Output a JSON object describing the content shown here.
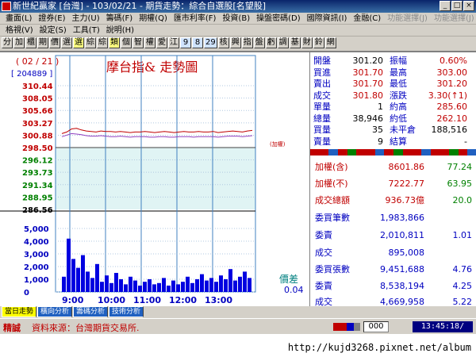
{
  "window": {
    "title": "新世紀贏家 [台灣] - 103/02/21 - 期貨走勢：綜合自選股[名望股]"
  },
  "menu": {
    "row1": [
      "畫面(L)",
      "證券(E)",
      "主力(U)",
      "籌碼(F)",
      "期權(Q)",
      "匯市利率(F)",
      "投資(B)",
      "操盤密碼(D)",
      "國際資訊(I)",
      "金融(C)",
      "功能選擇(J)",
      "功能選擇(J)"
    ],
    "row2": [
      "格視(V)",
      "設定(S)",
      "工具(T)",
      "說明(H)"
    ]
  },
  "toolbar": {
    "buttons": [
      "分",
      "加",
      "櫃",
      "期",
      "價",
      "選",
      "選",
      "綜",
      "綜",
      "類",
      "個",
      "智",
      "權",
      "愛",
      "江",
      "9",
      "8",
      "29",
      "核",
      "興",
      "指",
      "盤",
      "虧",
      "調",
      "基",
      "財",
      "鈴",
      "網"
    ]
  },
  "chart_data": {
    "type": "line",
    "title": "摩台指&  走勢圖",
    "date_label": "( 02 / 21 )",
    "volume_label": "[ 204889 ]",
    "reference_label": "(加權)",
    "y_ticks": [
      "310.44",
      "308.05",
      "305.66",
      "303.27",
      "300.88",
      "298.50",
      "296.12",
      "293.73",
      "291.34",
      "288.95",
      "286.56"
    ],
    "ylim": [
      286.56,
      310.44
    ],
    "reference_price": 298.5,
    "vol_ticks": [
      "5,000",
      "4,000",
      "3,000",
      "2,000",
      "1,000",
      "0"
    ],
    "vol_max": 5000,
    "x_ticks": [
      "9:00",
      "10:00",
      "11:00",
      "12:00",
      "13:00"
    ],
    "series": [
      {
        "values": [
          301.2,
          301.5,
          302.1,
          302.2,
          301.9,
          301.7,
          301.6,
          301.5,
          301.7,
          301.6,
          301.6,
          301.5,
          301.6,
          301.5,
          301.4,
          301.5,
          301.5,
          301.6,
          301.5,
          301.4,
          301.5,
          301.6,
          301.5,
          301.4,
          301.5,
          301.6,
          301.5,
          301.5,
          301.6,
          301.5,
          301.5,
          301.6,
          301.4,
          301.5,
          301.6,
          301.7,
          301.6,
          301.5,
          301.7,
          301.8
        ],
        "color": "#c00000"
      },
      {
        "values": [
          300.6,
          300.9,
          301.2,
          301.1,
          301.0,
          300.8,
          300.7,
          300.7,
          300.8,
          300.7,
          300.6,
          300.6,
          300.7,
          300.6,
          300.5,
          300.6,
          300.6,
          300.6,
          300.5,
          300.5,
          300.6,
          300.6,
          300.5,
          300.5,
          300.6,
          300.6,
          300.6,
          300.5,
          300.6,
          300.6,
          300.6,
          300.6,
          300.5,
          300.6,
          300.7,
          300.7,
          300.7,
          300.6,
          300.7,
          300.8
        ],
        "color": "#9040c0"
      }
    ],
    "volumes": [
      1200,
      4200,
      2600,
      1900,
      2900,
      1600,
      1100,
      2200,
      800,
      1300,
      700,
      1500,
      1000,
      600,
      1200,
      900,
      500,
      800,
      1000,
      600,
      700,
      1100,
      500,
      900,
      600,
      800,
      1200,
      700,
      1000,
      1400,
      900,
      1100,
      800,
      1300,
      1000,
      1800,
      900,
      1200,
      1600,
      1100
    ],
    "spread_label": "價差",
    "spread_value": "0.04"
  },
  "quote": {
    "rows": [
      {
        "l1": "開盤",
        "v1": "301.20",
        "l2": "振幅",
        "v2": "0.60%",
        "c1": "val-k",
        "c2": "val-r"
      },
      {
        "l1": "買進",
        "v1": "301.70",
        "l2": "最高",
        "v2": "303.00",
        "c1": "val-r",
        "c2": "val-r"
      },
      {
        "l1": "賣出",
        "v1": "301.70",
        "l2": "最低",
        "v2": "301.20",
        "c1": "val-r",
        "c2": "val-r"
      },
      {
        "l1": "成交",
        "v1": "301.80",
        "l2": "漲跌",
        "v2": "3.30(↑1)",
        "c1": "val-r",
        "c2": "val-r"
      },
      {
        "l1": "單量",
        "v1": "1",
        "l2": "約高",
        "v2": "285.60",
        "c1": "val-k",
        "c2": "val-r"
      },
      {
        "l1": "總量",
        "v1": "38,946",
        "l2": "約低",
        "v2": "262.10",
        "c1": "val-k",
        "c2": "val-r"
      },
      {
        "l1": "買量",
        "v1": "35",
        "l2": "未平倉",
        "v2": "188,516",
        "c1": "val-k",
        "c2": "val-k"
      },
      {
        "l1": "賣量",
        "v1": "9",
        "l2": "結算",
        "v2": "-",
        "c1": "val-k",
        "c2": "val-k"
      }
    ]
  },
  "market": {
    "rows": [
      {
        "label": "加權(含)",
        "value": "8601.86",
        "change": "77.24"
      },
      {
        "label": "加權(不)",
        "value": "7222.77",
        "change": "63.95"
      },
      {
        "label": "成交總額",
        "value": "936.73億",
        "change": "20.0"
      },
      {
        "label": "委買筆數",
        "value": "1,983,866",
        "change": ""
      },
      {
        "label": "委賣",
        "value": "2,010,811",
        "change": "1.01"
      },
      {
        "label": "成交",
        "value": "895,008",
        "change": ""
      },
      {
        "label": "委買張數",
        "value": "9,451,688",
        "change": "4.76"
      },
      {
        "label": "委賣",
        "value": "8,538,194",
        "change": "4.25"
      },
      {
        "label": "成交",
        "value": "4,669,958",
        "change": "5.22"
      }
    ]
  },
  "tabs": [
    "當日走勢",
    "橫向分析",
    "籌碼分析",
    "技術分析"
  ],
  "status": {
    "mode": "精誠",
    "source": "資料來源：台灣期貨交易所.",
    "code": "000",
    "clock": "13:45:18/"
  },
  "watermark": "http://kujd3268.pixnet.net/album",
  "colors": {
    "up": "#c00000",
    "down": "#008000",
    "label": "#0000c0",
    "panel_bg": "#e0f4f4"
  }
}
